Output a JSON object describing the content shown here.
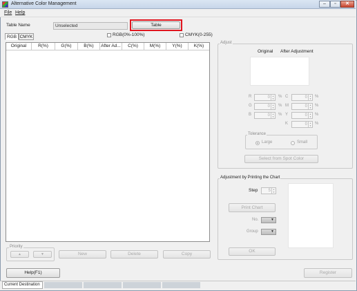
{
  "window": {
    "title": "Alternative Color Management",
    "minimize": "–",
    "maximize": "▫",
    "close": "✕"
  },
  "menu": {
    "file": "File",
    "help": "Help"
  },
  "top": {
    "table_name_label": "Table Name",
    "table_name_value": "Unselected",
    "table_button": "Table"
  },
  "tabs": [
    "RGB",
    "CMYK"
  ],
  "checkboxes": {
    "rgb": "RGB(0%-100%)",
    "cmyk": "CMYK(0-255)"
  },
  "table": {
    "columns": [
      "Original",
      "R(%)",
      "G(%)",
      "B(%)",
      "After Ad...",
      "C(%)",
      "M(%)",
      "Y(%)",
      "K(%)"
    ]
  },
  "priority": {
    "label": "Priority",
    "up": "▲",
    "down": "▼"
  },
  "actions": {
    "new": "New",
    "delete": "Delete",
    "copy": "Copy"
  },
  "adjust": {
    "label": "Adjust",
    "original": "Original",
    "after": "After Adjustment",
    "r": "R",
    "g": "G",
    "b": "B",
    "c": "C",
    "m": "M",
    "y": "Y",
    "k": "K",
    "zero": "0",
    "pct": "%",
    "tolerance": "Tolerance",
    "large": "Large",
    "small": "Small",
    "select_spot": "Select from Spot Color"
  },
  "printing": {
    "label": "Adjustment by Printing the Chart",
    "step": "Step",
    "step_value": "5",
    "print_chart": "Print Chart",
    "no": "No.",
    "group": "Group",
    "ok": "OK"
  },
  "bottom": {
    "help": "Help(F1)",
    "register": "Register"
  },
  "status": {
    "current_destination": "Current Destination"
  }
}
